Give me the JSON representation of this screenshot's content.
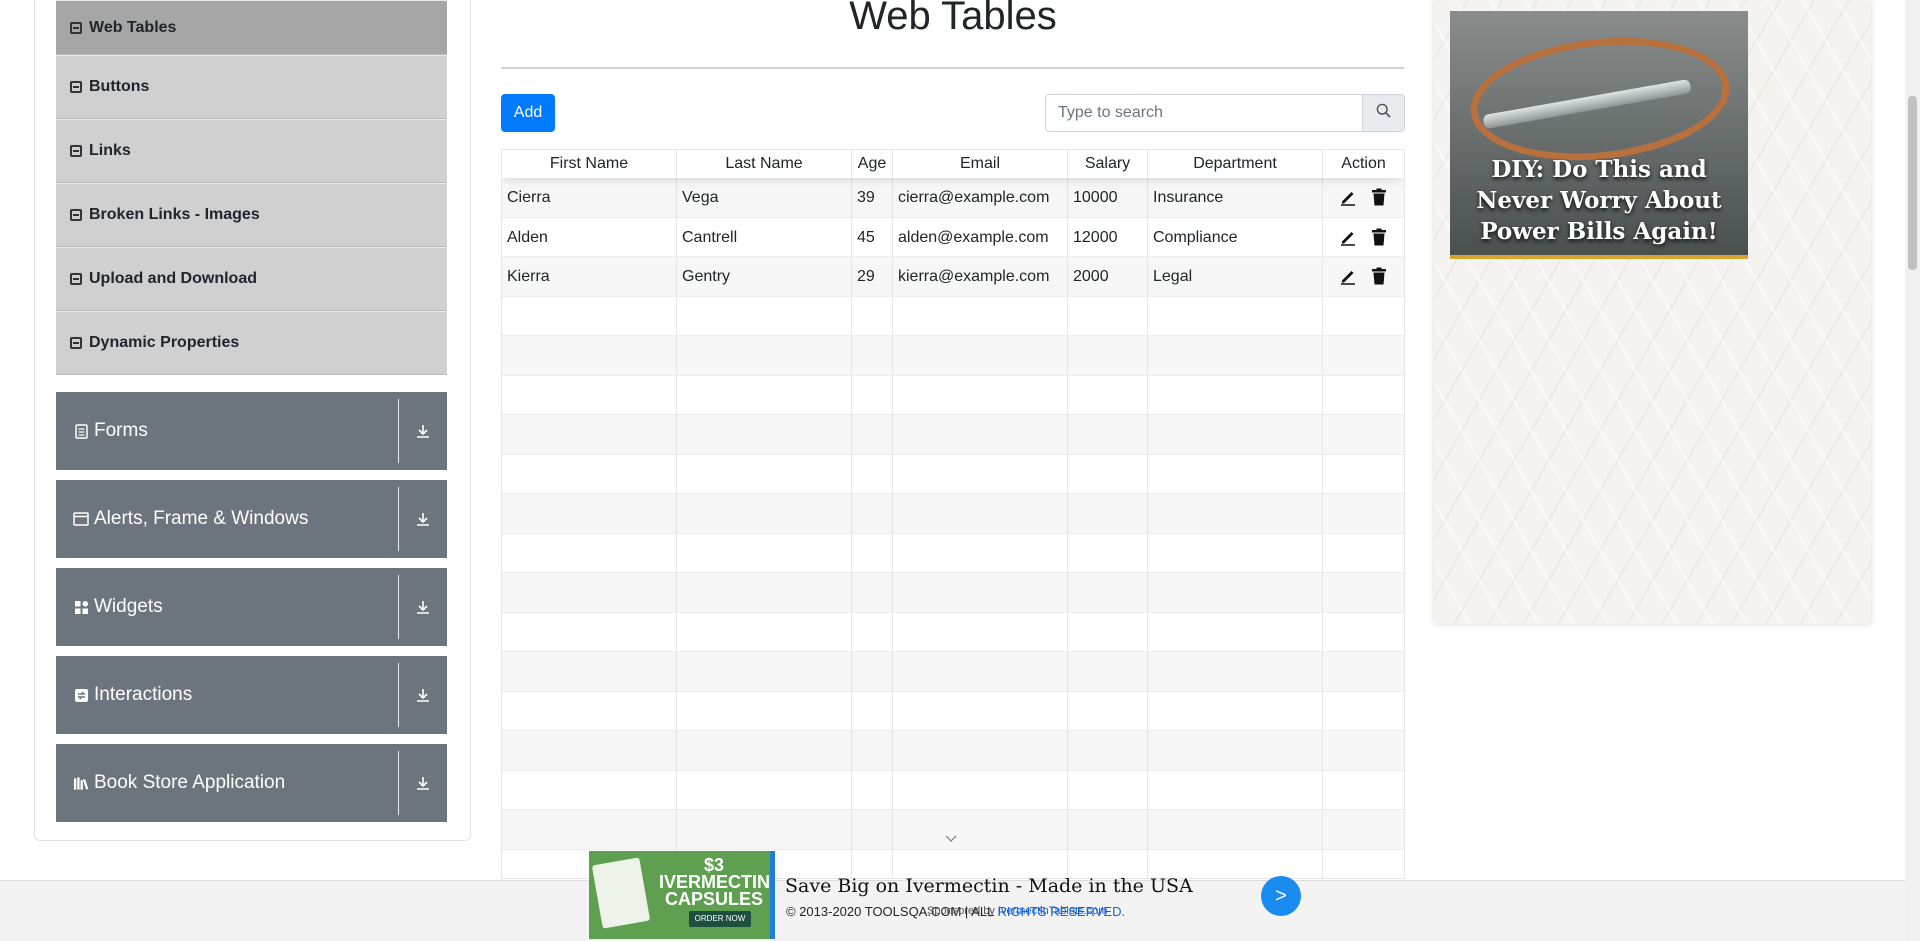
{
  "sidebar": {
    "items": [
      {
        "label": "Web Tables",
        "active": true
      },
      {
        "label": "Buttons"
      },
      {
        "label": "Links"
      },
      {
        "label": "Broken Links - Images"
      },
      {
        "label": "Upload and Download"
      },
      {
        "label": "Dynamic Properties"
      }
    ],
    "groups": [
      {
        "label": "Forms",
        "icon": "document-icon"
      },
      {
        "label": "Alerts, Frame & Windows",
        "icon": "window-icon"
      },
      {
        "label": "Widgets",
        "icon": "grid-icon"
      },
      {
        "label": "Interactions",
        "icon": "interaction-icon"
      },
      {
        "label": "Book Store Application",
        "icon": "books-icon"
      }
    ]
  },
  "main": {
    "title": "Web Tables",
    "add_label": "Add",
    "search_placeholder": "Type to search"
  },
  "table": {
    "columns": [
      "First Name",
      "Last Name",
      "Age",
      "Email",
      "Salary",
      "Department",
      "Action"
    ],
    "rows": [
      {
        "first": "Cierra",
        "last": "Vega",
        "age": "39",
        "email": "cierra@example.com",
        "salary": "10000",
        "dept": "Insurance"
      },
      {
        "first": "Alden",
        "last": "Cantrell",
        "age": "45",
        "email": "alden@example.com",
        "salary": "12000",
        "dept": "Compliance"
      },
      {
        "first": "Kierra",
        "last": "Gentry",
        "age": "29",
        "email": "kierra@example.com",
        "salary": "2000",
        "dept": "Legal"
      }
    ]
  },
  "side_ad": {
    "text": "DIY: Do This and Never Worry About Power Bills Again!"
  },
  "bottom_ad": {
    "price_text": "$3 IVERMECTIN CAPSULES",
    "order_text": "ORDER NOW",
    "headline": "Save Big on Ivermectin - Made in the USA",
    "sponsor_prefix": "Sponsored by",
    "sponsor_link": "IvermectinTablets.com",
    "go_label": ">"
  },
  "footer": {
    "copyright": "© 2013-2020 TOOLSQA.COM | ALL",
    "rights": "RIGHTS RESERVED."
  },
  "colors": {
    "primary": "#007bff",
    "group_bg": "#6c757d",
    "sidebar_item_bg": "#d0d0d0",
    "sidebar_active_bg": "#a6a6a6"
  }
}
